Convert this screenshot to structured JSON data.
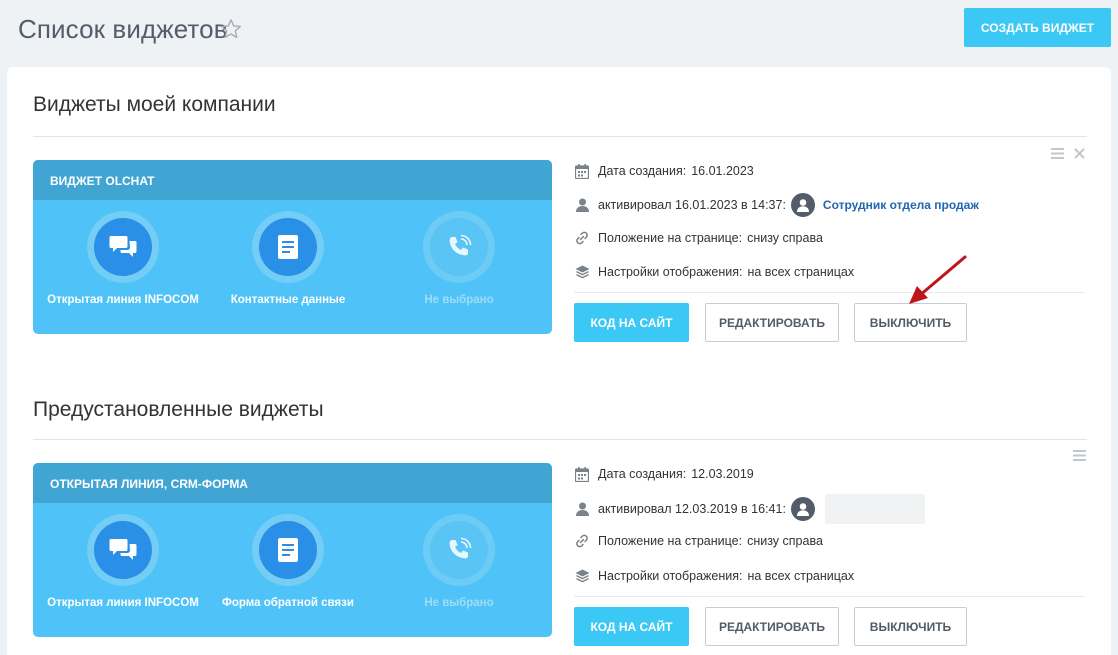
{
  "header": {
    "title": "Список виджетов",
    "create_button": "СОЗДАТЬ ВИДЖЕТ"
  },
  "sections": [
    {
      "title": "Виджеты моей компании",
      "widget": {
        "name": "ВИДЖЕТ OLCHAT",
        "items": [
          {
            "label": "Открытая линия INFOCOM",
            "icon": "chat-bubbles-icon",
            "active": true
          },
          {
            "label": "Контактные данные",
            "icon": "document-icon",
            "active": true
          },
          {
            "label": "Не выбрано",
            "icon": "phone-icon",
            "active": false
          }
        ]
      },
      "info": {
        "created_label": "Дата создания:",
        "created_value": "16.01.2023",
        "activated_label": "активировал 16.01.2023 в 14:37:",
        "activated_user": "Сотрудник отдела продаж",
        "position_label": "Положение на странице:",
        "position_value": "снизу справа",
        "display_label": "Настройки отображения:",
        "display_value": "на всех страницах"
      },
      "buttons": {
        "code": "КОД НА САЙТ",
        "edit": "РЕДАКТИРОВАТЬ",
        "disable": "ВЫКЛЮЧИТЬ"
      }
    },
    {
      "title": "Предустановленные виджеты",
      "widget": {
        "name": "ОТКРЫТАЯ ЛИНИЯ, CRM-ФОРМА",
        "items": [
          {
            "label": "Открытая линия INFOCOM",
            "icon": "chat-bubbles-icon",
            "active": true
          },
          {
            "label": "Форма обратной связи",
            "icon": "document-icon",
            "active": true
          },
          {
            "label": "Не выбрано",
            "icon": "phone-icon",
            "active": false
          }
        ]
      },
      "info": {
        "created_label": "Дата создания:",
        "created_value": "12.03.2019",
        "activated_label": "активировал 12.03.2019 в 16:41:",
        "activated_user": "",
        "position_label": "Положение на странице:",
        "position_value": "снизу справа",
        "display_label": "Настройки отображения:",
        "display_value": "на всех страницах"
      },
      "buttons": {
        "code": "КОД НА САЙТ",
        "edit": "РЕДАКТИРОВАТЬ",
        "disable": "ВЫКЛЮЧИТЬ"
      }
    }
  ],
  "colors": {
    "accent": "#3bc8f5",
    "card_head": "#40a5d3",
    "card_body": "#4fc3f7",
    "icon_circle": "#2a8fe6",
    "link": "#2066b0",
    "annotation_arrow": "#c0141b"
  }
}
